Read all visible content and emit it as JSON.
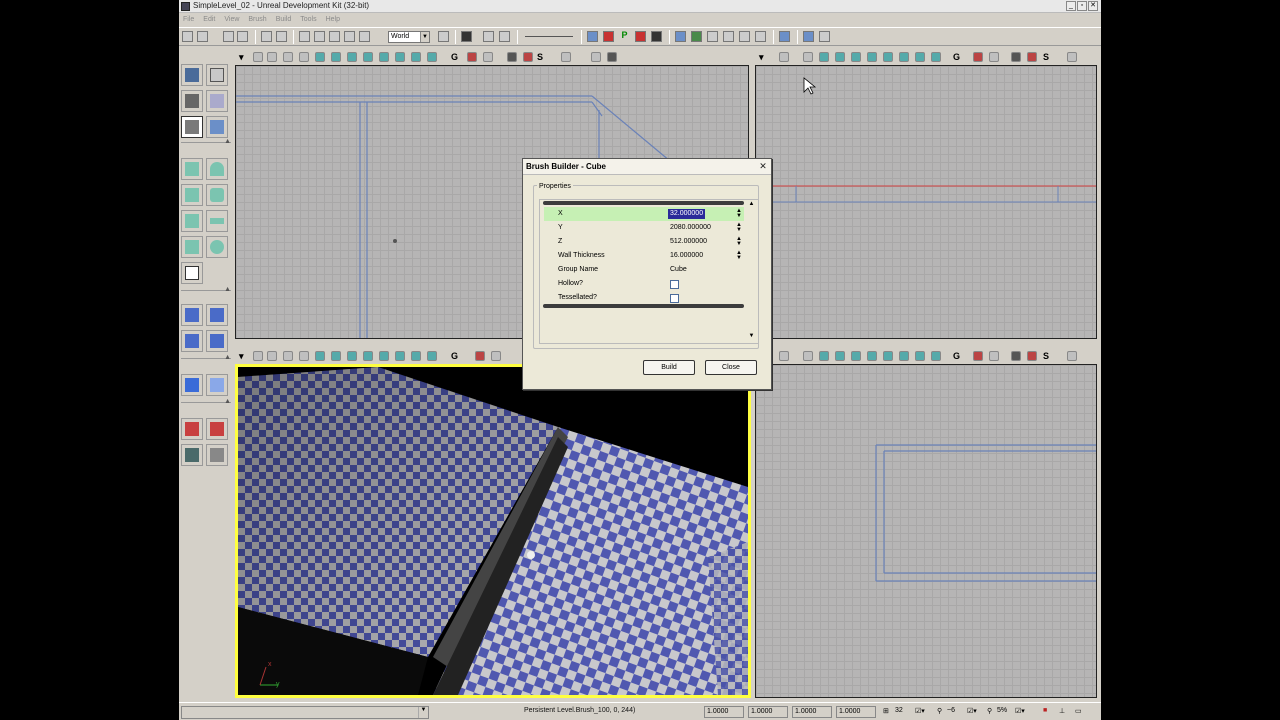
{
  "window": {
    "title": "SimpleLevel_02 - Unreal Development Kit (32-bit)",
    "buttons": [
      "_",
      "▫",
      "✕"
    ]
  },
  "menu": [
    "File",
    "Edit",
    "View",
    "Brush",
    "Build",
    "Tools",
    "Help"
  ],
  "toolbar": {
    "coord_system": "World"
  },
  "dialog": {
    "title": "Brush Builder - Cube",
    "group_label": "Properties",
    "properties": [
      {
        "name": "X",
        "value": "32.000000",
        "selected": true
      },
      {
        "name": "Y",
        "value": "2080.000000"
      },
      {
        "name": "Z",
        "value": "512.000000"
      },
      {
        "name": "Wall Thickness",
        "value": "16.000000"
      },
      {
        "name": "Group Name",
        "value": "Cube"
      },
      {
        "name": "Hollow?",
        "value": "",
        "checkbox": true,
        "checked": false
      },
      {
        "name": "Tessellated?",
        "value": "",
        "checkbox": true,
        "checked": false
      }
    ],
    "build_label": "Build",
    "close_label": "Close"
  },
  "perspective": {
    "axis_x": "x",
    "axis_y": "y"
  },
  "statusbar": {
    "text": "Persistent Level.Brush_100, 0, 244)",
    "values": [
      "1.0000",
      "1.0000",
      "1.0000",
      "1.0000"
    ],
    "grid": "32",
    "rot": "~6",
    "scale": "5%"
  },
  "colors": {
    "chrome": "#d4d0c8",
    "grid_bg": "#b6b5b5",
    "brush_line": "#6a82b8",
    "selection_highlight": "#ffff40",
    "checker_a": "#4a52a8",
    "checker_b": "#b8b8bc"
  }
}
